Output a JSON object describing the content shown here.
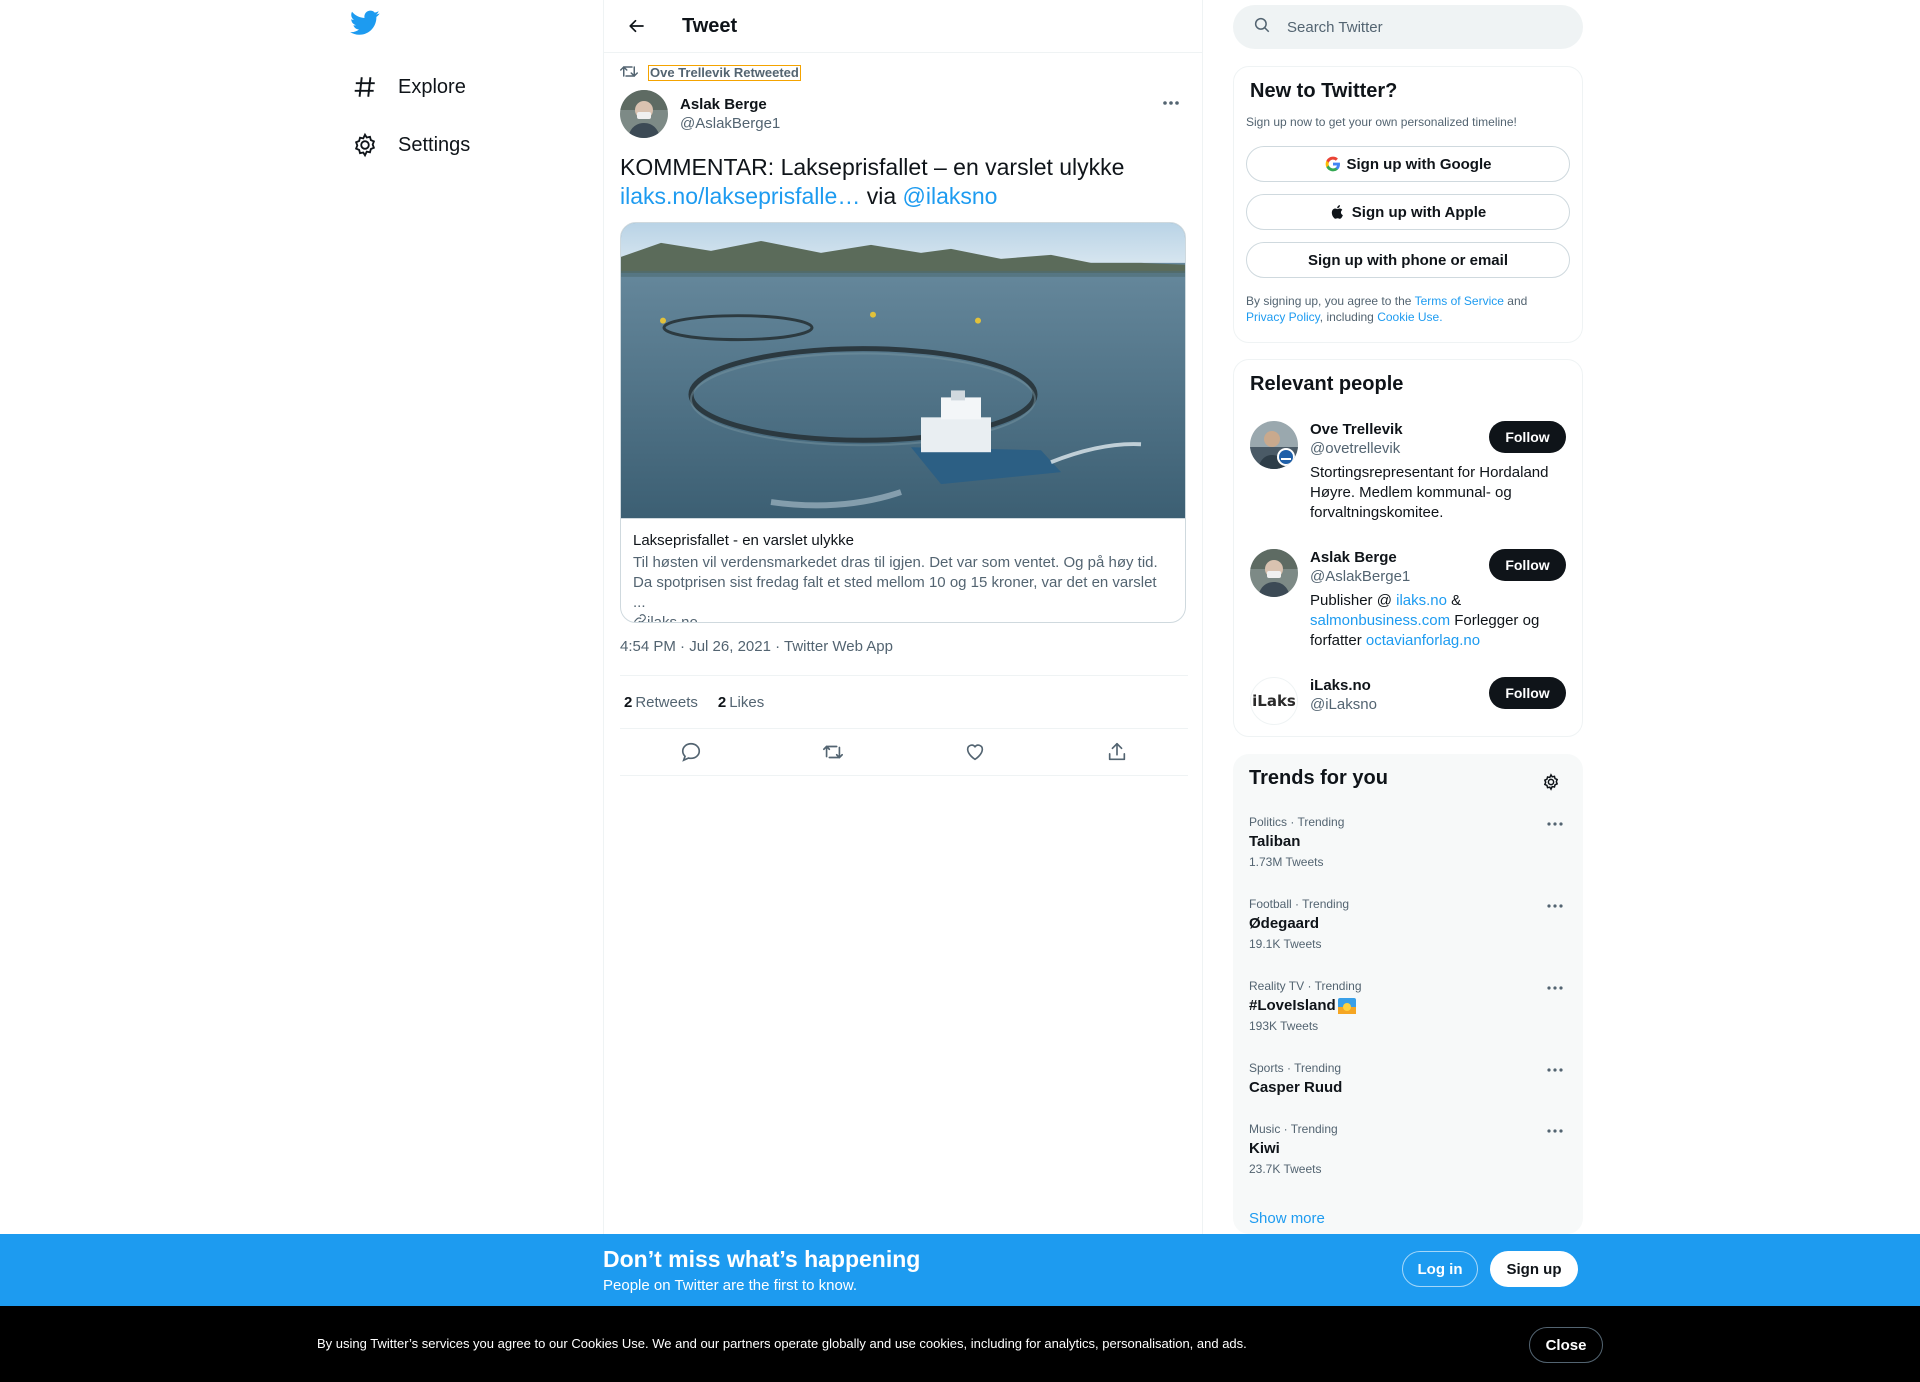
{
  "nav": {
    "logo_icon": "twitter-bird-icon",
    "items": [
      {
        "label": "Explore",
        "icon": "hashtag-icon"
      },
      {
        "label": "Settings",
        "icon": "gear-icon"
      }
    ]
  },
  "header": {
    "title": "Tweet"
  },
  "tweet": {
    "retweeted_by": "Ove Trellevik Retweeted",
    "author_name": "Aslak Berge",
    "author_handle": "@AslakBerge1",
    "text_main": "KOMMENTAR: Lakseprisfallet – en varslet ulykke",
    "link_text": "ilaks.no/lakseprisfalle…",
    "via_text": "via",
    "mention": "@ilaksno",
    "card": {
      "title": "Lakseprisfallet - en varslet ulykke",
      "description": "Til høsten vil verdensmarkedet dras til igjen. Det var som ventet. Og på høy tid. Da spotprisen sist fredag falt et sted mellom 10 og 15 kroner, var det en varslet ...",
      "domain": "ilaks.no"
    },
    "time": "4:54 PM",
    "date": "Jul 26, 2021",
    "source": "Twitter Web App",
    "retweets_count": "2",
    "retweets_label": "Retweets",
    "likes_count": "2",
    "likes_label": "Likes"
  },
  "search": {
    "placeholder": "Search Twitter"
  },
  "new_to_twitter": {
    "title": "New to Twitter?",
    "subtitle": "Sign up now to get your own personalized timeline!",
    "google_label": "Sign up with Google",
    "apple_label": "Sign up with Apple",
    "phone_label": "Sign up with phone or email",
    "legal_1": "By signing up, you agree to the",
    "terms": "Terms of Service",
    "legal_2": "and",
    "privacy": "Privacy Policy",
    "legal_3": ", including",
    "cookie": "Cookie Use."
  },
  "relevant_people": {
    "title": "Relevant people",
    "follow_label": "Follow",
    "people": [
      {
        "name": "Ove Trellevik",
        "handle": "@ovetrellevik",
        "bio": "Stortingsrepresentant for Hordaland Høyre. Medlem kommunal- og forvaltningskomitee."
      },
      {
        "name": "Aslak Berge",
        "handle": "@AslakBerge1",
        "bio_1": "Publisher @",
        "bio_link_1": "ilaks.no",
        "bio_2": "&",
        "bio_link_2": "salmonbusiness.com",
        "bio_3": "Forlegger og forfatter",
        "bio_link_3": "octavianforlag.no"
      },
      {
        "name": "iLaks.no",
        "handle": "@iLaksno",
        "avatar_text": "iLaks"
      }
    ]
  },
  "trends": {
    "title": "Trends for you",
    "items": [
      {
        "meta": "Politics · Trending",
        "name": "Taliban",
        "count": "1.73M Tweets"
      },
      {
        "meta": "Football · Trending",
        "name": "Ødegaard",
        "count": "19.1K Tweets"
      },
      {
        "meta": "Reality TV · Trending",
        "name": "#LoveIsland",
        "count": "193K Tweets"
      },
      {
        "meta": "Sports · Trending",
        "name": "Casper Ruud",
        "count": ""
      },
      {
        "meta": "Music · Trending",
        "name": "Kiwi",
        "count": "23.7K Tweets"
      }
    ],
    "show_more": "Show more"
  },
  "bottom_bar": {
    "title": "Don’t miss what’s happening",
    "subtitle": "People on Twitter are the first to know.",
    "login": "Log in",
    "signup": "Sign up"
  },
  "cookie_bar": {
    "text": "By using Twitter’s services you agree to our Cookies Use. We and our partners operate globally and use cookies, including for analytics, personalisation, and ads.",
    "close": "Close"
  },
  "colors": {
    "accent": "#1d9bf0",
    "text": "#0f1419",
    "muted": "#536471"
  }
}
